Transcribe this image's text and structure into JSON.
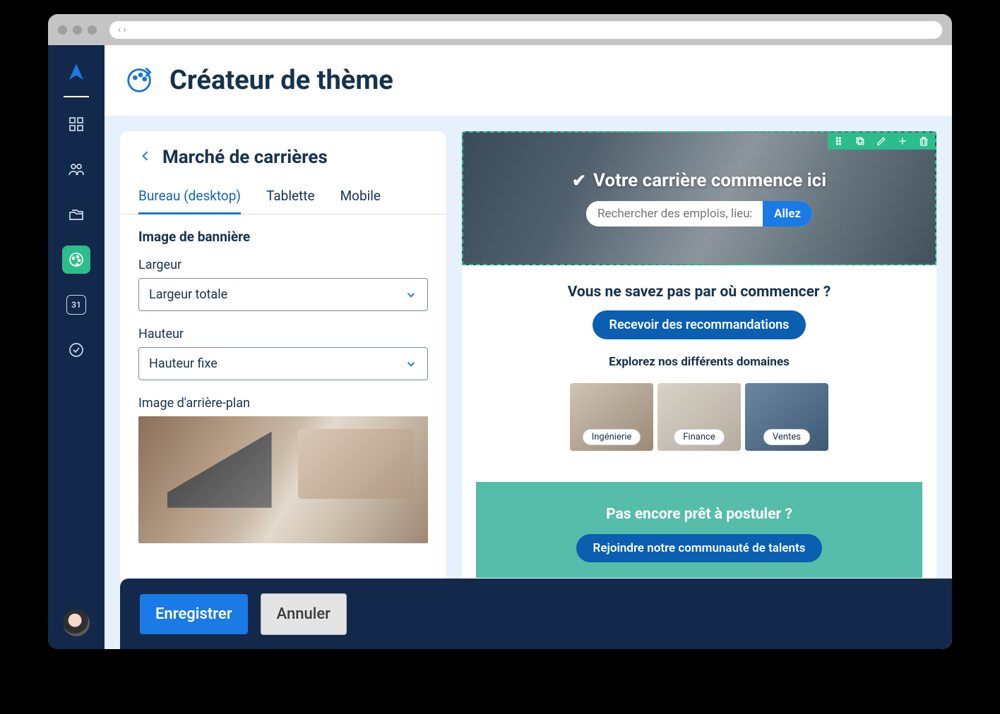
{
  "browser": {
    "nav_glyph": "‹ ›"
  },
  "sidebar": {
    "calendar_day": "31"
  },
  "header": {
    "title": "Créateur de thème"
  },
  "panel": {
    "title": "Marché de carrières",
    "tabs": [
      {
        "label": "Bureau (desktop)",
        "active": true
      },
      {
        "label": "Tablette",
        "active": false
      },
      {
        "label": "Mobile",
        "active": false
      }
    ],
    "section_title": "Image de bannière",
    "width_label": "Largeur",
    "width_value": "Largeur totale",
    "height_label": "Hauteur",
    "height_value": "Hauteur fixe",
    "bg_label": "Image d'arrière-plan"
  },
  "preview": {
    "banner_title": "Votre carrière commence ici",
    "search_placeholder": "Rechercher des emplois, lieux",
    "search_go": "Allez",
    "help_heading": "Vous ne savez pas par où commencer ?",
    "recommend_btn": "Recevoir des recommandations",
    "domains_heading": "Explorez nos différents domaines",
    "domains": [
      {
        "label": "Ingénierie"
      },
      {
        "label": "Finance"
      },
      {
        "label": "Ventes"
      }
    ],
    "cta_heading": "Pas encore prêt à postuler ?",
    "cta_button": "Rejoindre notre communauté de talents"
  },
  "actions": {
    "save": "Enregistrer",
    "cancel": "Annuler"
  }
}
